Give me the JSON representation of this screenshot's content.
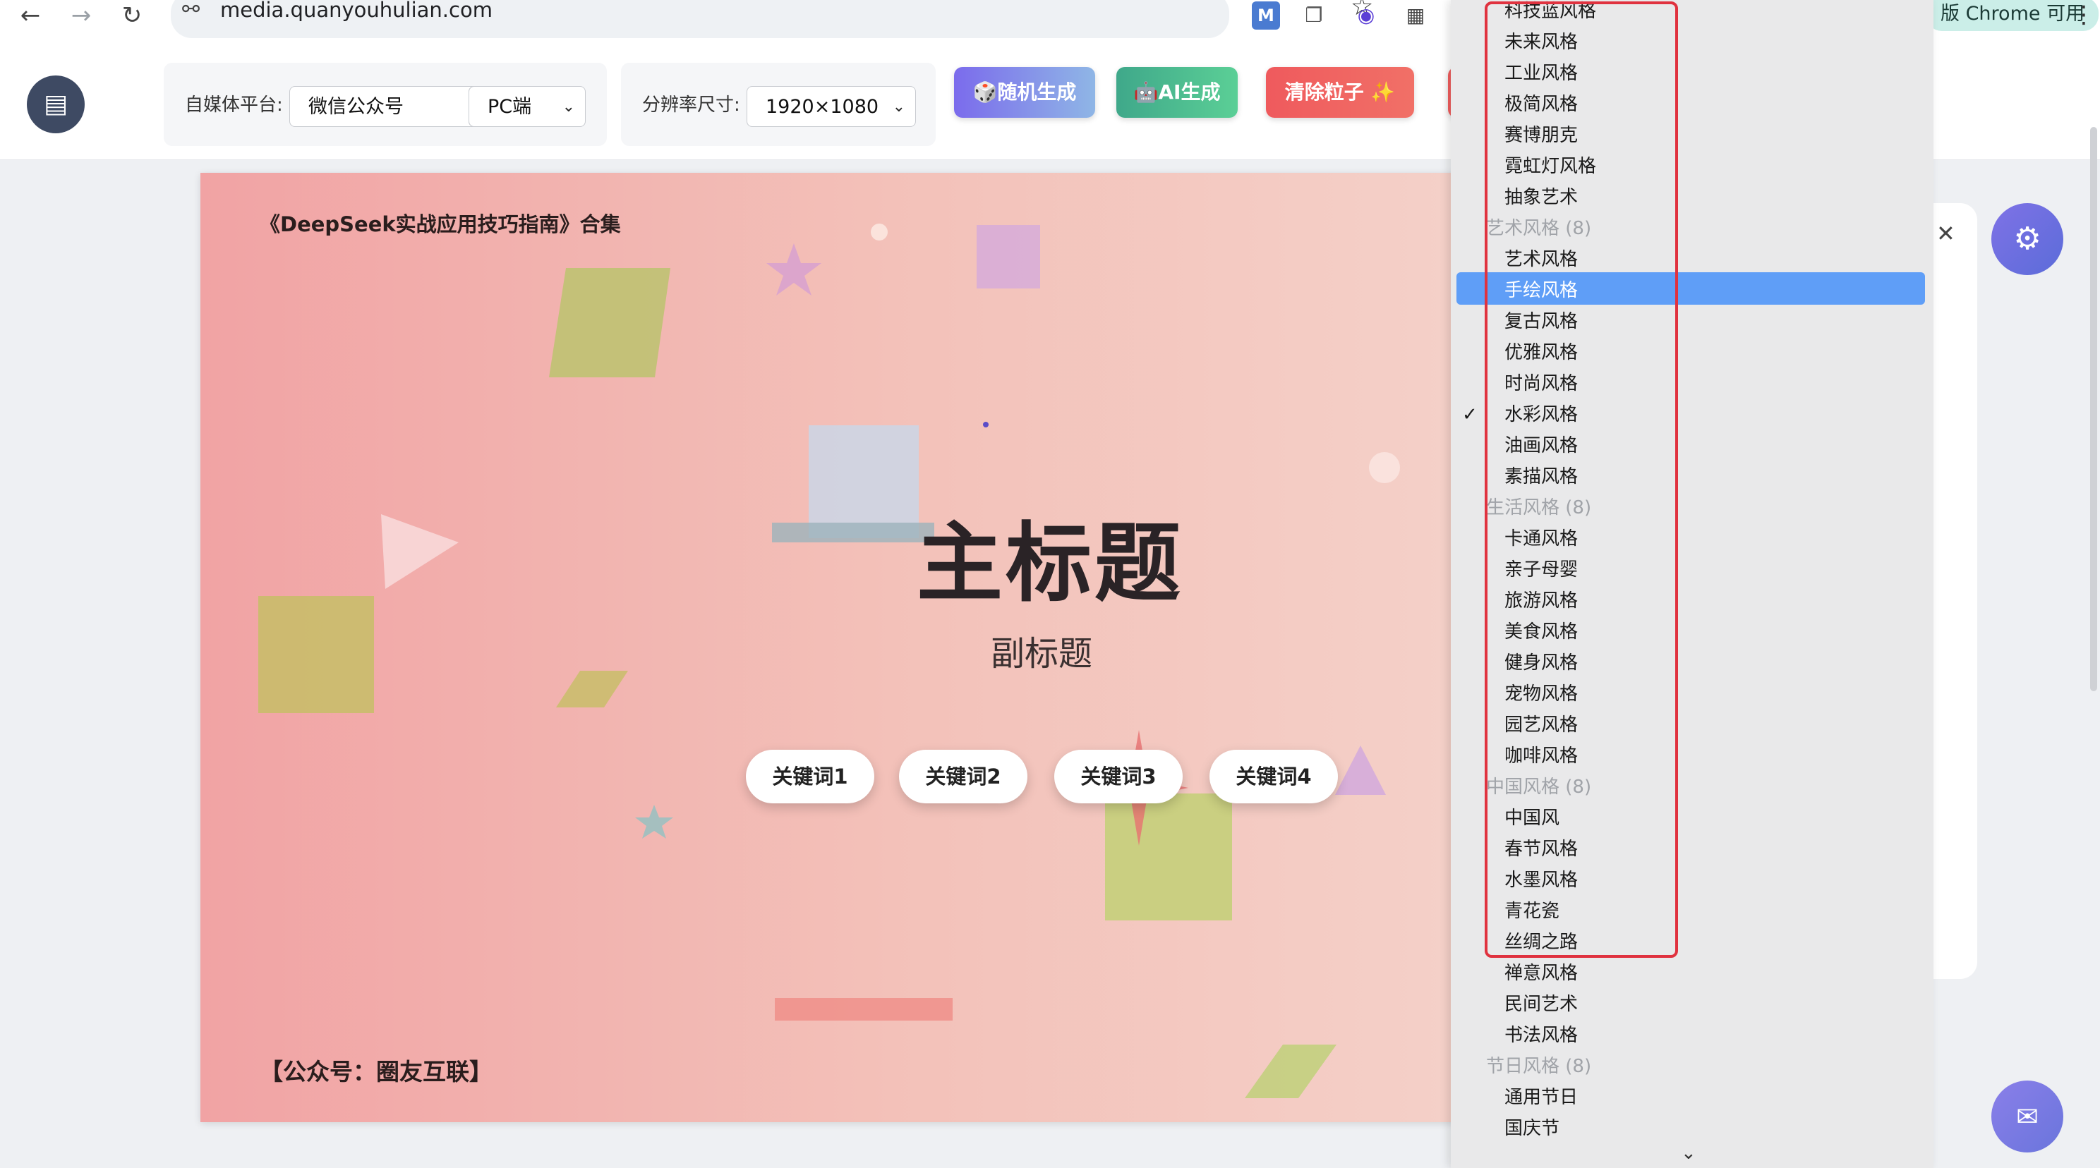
{
  "browser": {
    "url": "media.quanyouhulian.com",
    "chrome_available": "版 Chrome 可用"
  },
  "toolbar": {
    "platform_label": "自媒体平台:",
    "platform_value": "微信公众号",
    "device_value": "PC端",
    "resolution_label": "分辨率尺寸:",
    "resolution_value": "1920×1080",
    "random_button": "🎲随机生成",
    "ai_button": "🤖AI生成",
    "clear_button": "清除粒子 ✨"
  },
  "canvas": {
    "series_title": "《DeepSeek实战应用技巧指南》合集",
    "main_title": "主标题",
    "sub_title": "副标题",
    "keywords": [
      "关键词1",
      "关键词2",
      "关键词3",
      "关键词4"
    ],
    "footer": "【公众号：圈友互联】"
  },
  "dropdown": {
    "items": [
      {
        "kind": "opt",
        "text": "科技蓝风格"
      },
      {
        "kind": "opt",
        "text": "未来风格"
      },
      {
        "kind": "opt",
        "text": "工业风格"
      },
      {
        "kind": "opt",
        "text": "极简风格"
      },
      {
        "kind": "opt",
        "text": "赛博朋克"
      },
      {
        "kind": "opt",
        "text": "霓虹灯风格"
      },
      {
        "kind": "opt",
        "text": "抽象艺术"
      },
      {
        "kind": "grp",
        "text": "艺术风格 (8)"
      },
      {
        "kind": "opt",
        "text": "艺术风格"
      },
      {
        "kind": "opt",
        "text": "手绘风格",
        "highlighted": true
      },
      {
        "kind": "opt",
        "text": "复古风格"
      },
      {
        "kind": "opt",
        "text": "优雅风格"
      },
      {
        "kind": "opt",
        "text": "时尚风格"
      },
      {
        "kind": "opt",
        "text": "水彩风格",
        "checked": true
      },
      {
        "kind": "opt",
        "text": "油画风格"
      },
      {
        "kind": "opt",
        "text": "素描风格"
      },
      {
        "kind": "grp",
        "text": "生活风格 (8)"
      },
      {
        "kind": "opt",
        "text": "卡通风格"
      },
      {
        "kind": "opt",
        "text": "亲子母婴"
      },
      {
        "kind": "opt",
        "text": "旅游风格"
      },
      {
        "kind": "opt",
        "text": "美食风格"
      },
      {
        "kind": "opt",
        "text": "健身风格"
      },
      {
        "kind": "opt",
        "text": "宠物风格"
      },
      {
        "kind": "opt",
        "text": "园艺风格"
      },
      {
        "kind": "opt",
        "text": "咖啡风格"
      },
      {
        "kind": "grp",
        "text": "中国风格 (8)"
      },
      {
        "kind": "opt",
        "text": "中国风"
      },
      {
        "kind": "opt",
        "text": "春节风格"
      },
      {
        "kind": "opt",
        "text": "水墨风格"
      },
      {
        "kind": "opt",
        "text": "青花瓷"
      },
      {
        "kind": "opt",
        "text": "丝绸之路"
      },
      {
        "kind": "opt",
        "text": "禅意风格"
      },
      {
        "kind": "opt",
        "text": "民间艺术"
      },
      {
        "kind": "opt",
        "text": "书法风格"
      },
      {
        "kind": "grp",
        "text": "节日风格 (8)"
      },
      {
        "kind": "opt",
        "text": "通用节日"
      },
      {
        "kind": "opt",
        "text": "国庆节"
      }
    ]
  }
}
